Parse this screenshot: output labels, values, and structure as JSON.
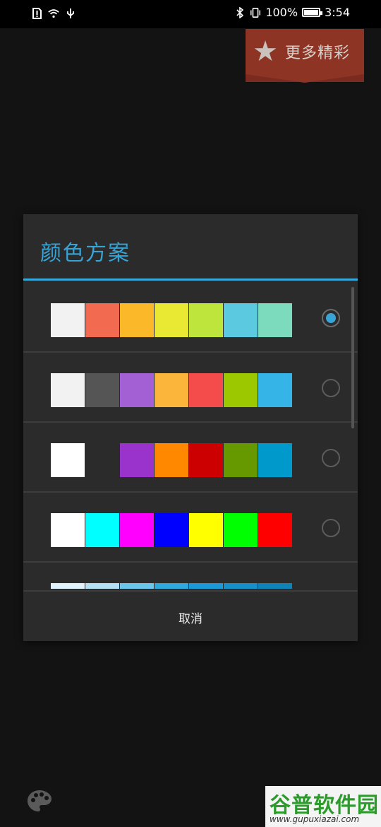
{
  "status_bar": {
    "left_icons": [
      "alert-icon",
      "wifi-icon",
      "usb-icon"
    ],
    "battery_percent": "100%",
    "battery_level": 1.0,
    "time": "3:54"
  },
  "banner": {
    "label": "更多精彩"
  },
  "dialog": {
    "title": "颜色方案",
    "cancel_label": "取消",
    "selected_index": 0,
    "schemes": [
      [
        "#f2f2f2",
        "#f26a4f",
        "#fbb829",
        "#e9e832",
        "#bee53c",
        "#5bc9e0",
        "#7ddbbd"
      ],
      [
        "#f2f2f2",
        "#555555",
        "#a35fd4",
        "#fbb53a",
        "#f44b4b",
        "#9cc800",
        "#35b4e8"
      ],
      [
        "#ffffff",
        "#2b2b2b",
        "#9933cc",
        "#ff8800",
        "#cc0000",
        "#669900",
        "#0099cc"
      ],
      [
        "#ffffff",
        "#00ffff",
        "#ff00ff",
        "#0000ff",
        "#ffff00",
        "#00ff00",
        "#ff0000"
      ],
      [
        "#e0f2fb",
        "#b5e0f4",
        "#6cc6eb",
        "#2fa8de",
        "#1a9ad6",
        "#1590c9",
        "#0f83b8"
      ]
    ]
  },
  "watermark": {
    "name": "谷普软件园",
    "url": "www.gupuxiazai.com"
  },
  "colors": {
    "accent": "#35a7d9",
    "dialog_bg": "#2b2b2b",
    "page_bg": "#131313"
  }
}
